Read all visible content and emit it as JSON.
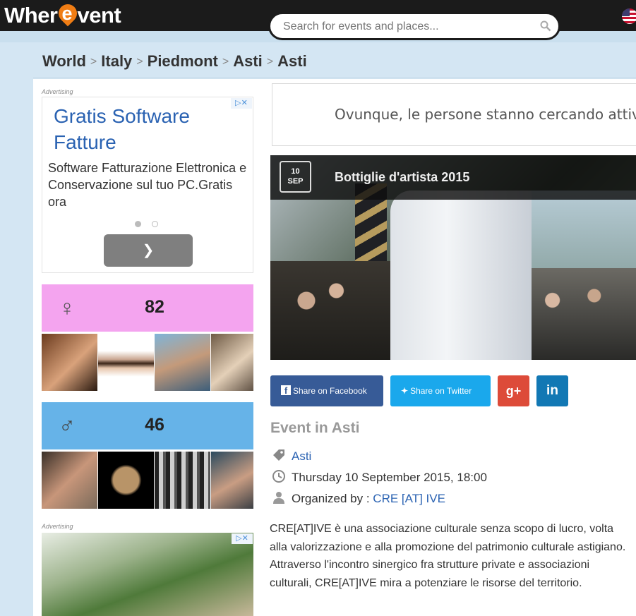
{
  "header": {
    "logo_prefix": "Wher",
    "logo_e": "e",
    "logo_suffix": "vent",
    "search_placeholder": "Search for events and places...",
    "language_flag": "us-flag-icon"
  },
  "breadcrumb": [
    "World",
    "Italy",
    "Piedmont",
    "Asti",
    "Asti"
  ],
  "ads": {
    "label": "Advertising",
    "ad1": {
      "headline": "Gratis Software Fatture",
      "body": "Software Fatturazione Elettronica e Conservazione sul tuo PC.Gratis ora",
      "cta_icon": "chevron-right-icon"
    },
    "banner_text": "Ovunque, le persone stanno cercando attività"
  },
  "audience": {
    "female": {
      "symbol": "♀",
      "count": "82",
      "color": "#f4a4ef"
    },
    "male": {
      "symbol": "♂",
      "count": "46",
      "color": "#66b3e8"
    }
  },
  "event": {
    "date_day": "10",
    "date_month": "SEP",
    "title": "Bottiglie d'artista 2015",
    "section_title": "Event in Asti",
    "location": "Asti",
    "datetime": "Thursday 10 September 2015, 18:00",
    "organized_prefix": "Organized by :",
    "organizer": "CRE [AT] IVE",
    "description": "CRE[AT]IVE è una associazione culturale senza scopo di lucro, volta alla valorizzazione e alla promozione del patrimonio culturale astigiano. Attraverso l'incontro sinergico fra strutture private e associazioni culturali, CRE[AT]IVE mira a potenziare le risorse del territorio."
  },
  "share": {
    "facebook": "Share on Facebook",
    "twitter": "Share on Twitter",
    "googleplus": "g+",
    "linkedin": "in"
  },
  "colors": {
    "topbar": "#1b1b1b",
    "accent": "#f07d14",
    "link": "#2a62b2",
    "facebook": "#375b97",
    "twitter": "#1aa8ec",
    "googleplus": "#dd4b39",
    "linkedin": "#1278b4"
  }
}
